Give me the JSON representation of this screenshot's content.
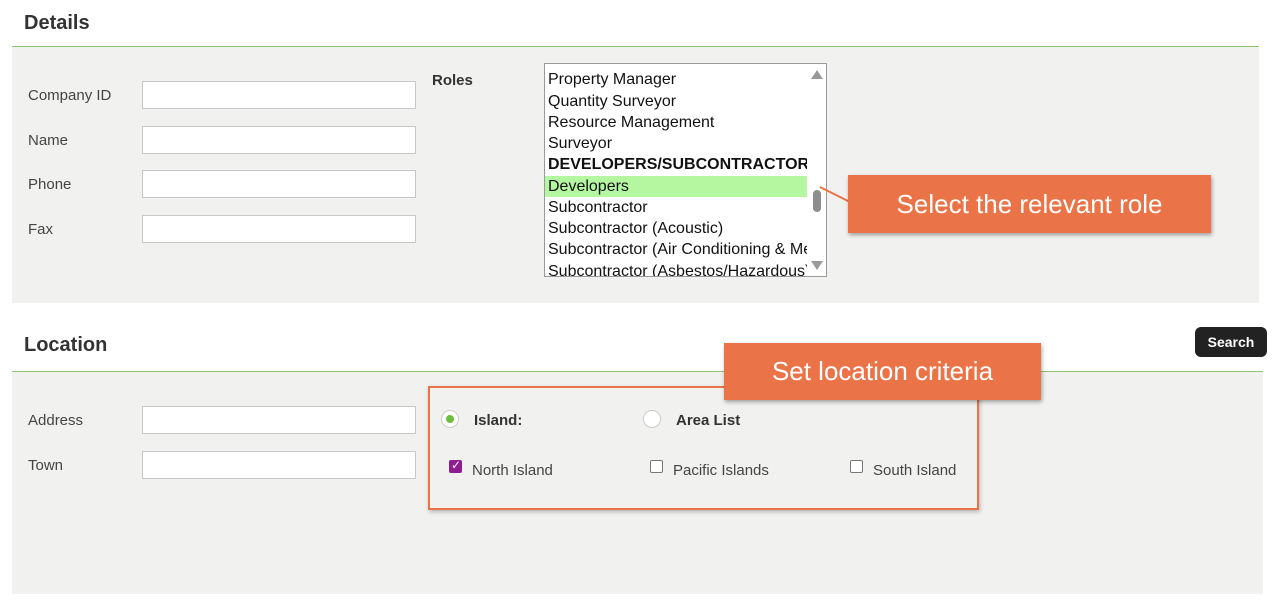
{
  "details": {
    "heading": "Details",
    "fields": [
      {
        "label": "Company ID",
        "value": ""
      },
      {
        "label": "Name",
        "value": ""
      },
      {
        "label": "Phone",
        "value": ""
      },
      {
        "label": "Fax",
        "value": ""
      }
    ],
    "roles_label": "Roles",
    "roles_options": [
      {
        "label": "Property Manager",
        "group": false,
        "selected": false
      },
      {
        "label": "Quantity Surveyor",
        "group": false,
        "selected": false
      },
      {
        "label": "Resource Management",
        "group": false,
        "selected": false
      },
      {
        "label": "Surveyor",
        "group": false,
        "selected": false
      },
      {
        "label": "DEVELOPERS/SUBCONTRACTORS",
        "group": true,
        "selected": false
      },
      {
        "label": "Developers",
        "group": false,
        "selected": true
      },
      {
        "label": "Subcontractor",
        "group": false,
        "selected": false
      },
      {
        "label": "Subcontractor (Acoustic)",
        "group": false,
        "selected": false
      },
      {
        "label": "Subcontractor (Air Conditioning & Mechanical)",
        "group": false,
        "selected": false
      },
      {
        "label": "Subcontractor (Asbestos/Hazardous)",
        "group": false,
        "selected": false
      }
    ],
    "selected_highlight_color": "#b5f7a0",
    "callout": "Select the relevant role"
  },
  "location": {
    "heading": "Location",
    "search_label": "Search",
    "fields": [
      {
        "label": "Address",
        "value": ""
      },
      {
        "label": "Town",
        "value": ""
      }
    ],
    "callout": "Set location criteria",
    "radios": [
      {
        "label": "Island:",
        "checked": true
      },
      {
        "label": "Area List",
        "checked": false
      }
    ],
    "islands": [
      {
        "label": "North Island",
        "checked": true
      },
      {
        "label": "Pacific Islands",
        "checked": false
      },
      {
        "label": "South Island",
        "checked": false
      }
    ]
  },
  "colors": {
    "accent_rule": "#8fc46a",
    "callout": "#ea7347",
    "panel": "#f1f1ef",
    "checkbox_checked": "#8e1e8e",
    "radio_dot": "#6cbf3f"
  }
}
